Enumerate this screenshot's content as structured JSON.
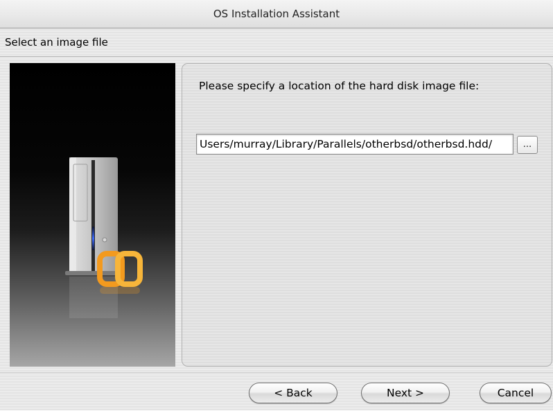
{
  "window": {
    "title": "OS Installation Assistant"
  },
  "header": {
    "title": "Select an image file"
  },
  "sidebar": {
    "illustration": "parallels-computer-tower-icon"
  },
  "main": {
    "instruction": "Please specify a location of the hard disk image file:",
    "path_value": "/Users/murray/Library/Parallels/otherbsd/otherbsd.hdd",
    "browse_label": "..."
  },
  "footer": {
    "back_label": "< Back",
    "next_label": "Next >",
    "cancel_label": "Cancel"
  },
  "colors": {
    "logo_orange": "#f39a1e",
    "tower_light": "#c4c4c4",
    "power_blue": "#3d6bff"
  }
}
